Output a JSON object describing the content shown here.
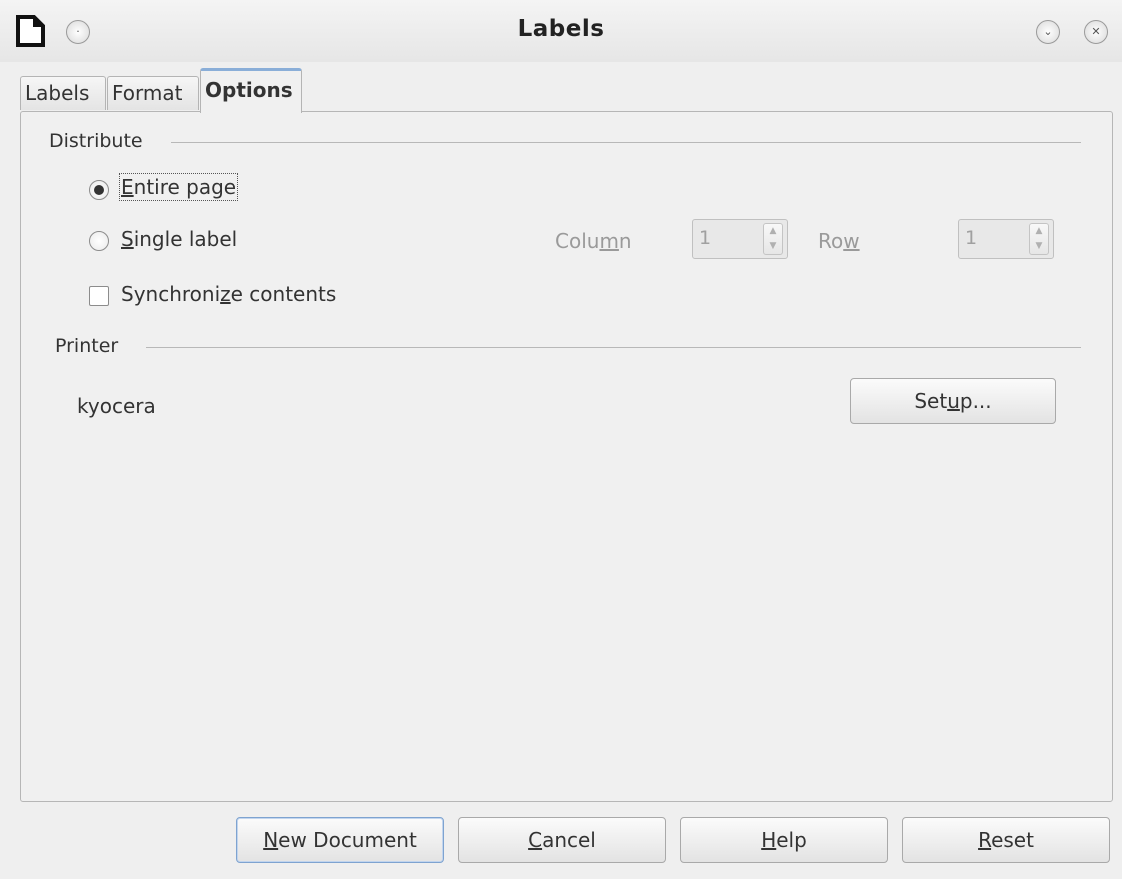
{
  "window": {
    "title": "Labels"
  },
  "tabs": [
    {
      "label": "Labels",
      "active": false
    },
    {
      "label": "Format",
      "active": false
    },
    {
      "label": "Options",
      "active": true
    }
  ],
  "distribute": {
    "section_label": "Distribute",
    "entire_page": {
      "pre": "",
      "mn": "E",
      "post": "ntire page",
      "checked": true
    },
    "single_label": {
      "pre": "",
      "mn": "S",
      "post": "ingle label",
      "checked": false
    },
    "column": {
      "pre": "Colu",
      "mn": "m",
      "post": "n",
      "value": "1"
    },
    "row": {
      "pre": "Ro",
      "mn": "w",
      "post": "",
      "value": "1"
    },
    "synchronize": {
      "pre": "Synchroni",
      "mn": "z",
      "post": "e contents",
      "checked": false
    }
  },
  "printer": {
    "section_label": "Printer",
    "name": "kyocera",
    "setup": {
      "pre": "Set",
      "mn": "u",
      "post": "p..."
    }
  },
  "buttons": {
    "new_document": {
      "pre": "",
      "mn": "N",
      "post": "ew Document"
    },
    "cancel": {
      "pre": "",
      "mn": "C",
      "post": "ancel"
    },
    "help": {
      "pre": "",
      "mn": "H",
      "post": "elp"
    },
    "reset": {
      "pre": "",
      "mn": "R",
      "post": "eset"
    }
  },
  "colors": {
    "accent": "#8aaed8",
    "default_button_border": "#7ea3d0",
    "background": "#efefef"
  },
  "icons": [
    "document-app-icon",
    "window-menu-icon",
    "minimize-icon",
    "close-icon"
  ]
}
